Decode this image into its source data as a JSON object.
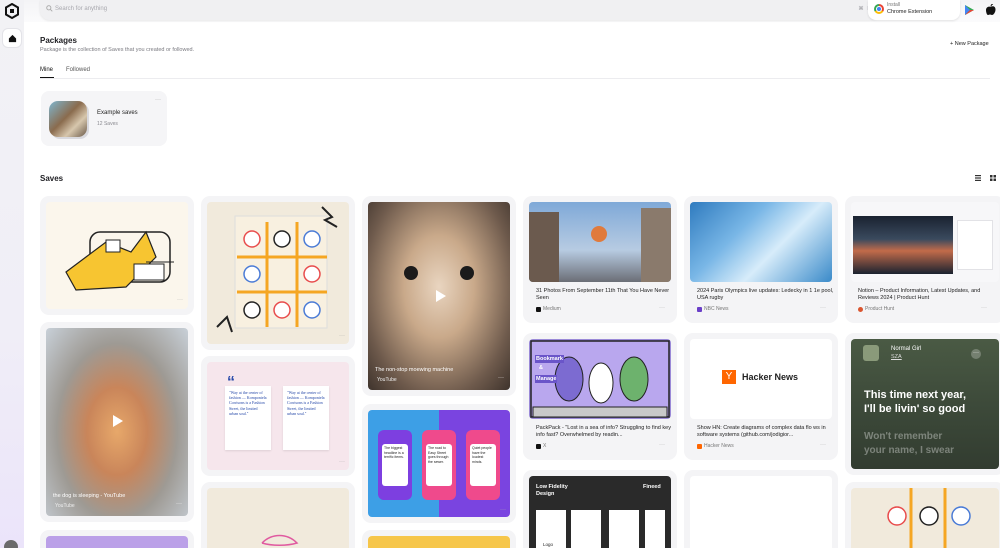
{
  "search": {
    "placeholder": "Search for anything",
    "shortcut": "⌘ K"
  },
  "extension": {
    "line1": "Install",
    "line2": "Chrome Extension"
  },
  "packages": {
    "title": "Packages",
    "subtitle": "Package is the collection of Saves that you created or followed.",
    "new_label": "+ New Package",
    "tabs": [
      "Mine",
      "Followed"
    ],
    "items": [
      {
        "name": "Example saves",
        "count": "12 Saves"
      }
    ]
  },
  "saves": {
    "title": "Saves",
    "cards": [
      {
        "title": "31 Photos From September 11th That You Have Never Seen",
        "source": "Medium"
      },
      {
        "title": "2024 Paris Olympics live updates: Ledecky in 1 1e pool, USA rugby",
        "source": "NBC News"
      },
      {
        "title": "Notion – Product Information, Latest Updates, and Reviews 2024 | Product Hunt",
        "source": "Product Hunt"
      },
      {
        "title": "The non-stop moewing machine",
        "source": "YouTube"
      },
      {
        "title": "the dog is sleeping - YouTube",
        "source": "YouTube"
      },
      {
        "title": "PackPack - \"Lost in a sea of info? Struggling to find key info fast? Overwhelmed by readin...",
        "source": "X"
      },
      {
        "title": "Show HN: Create diagrams of complex data flo ws in software systems (github.com/jodigior...",
        "source": "Hacker News"
      }
    ],
    "hn_logo": "Y",
    "hn_name": "Hacker News",
    "song": {
      "title": "Normal Girl",
      "artist": "SZA",
      "lyric1": "This time next year,",
      "lyric2": "I'll be livin' so good",
      "lyric3": "Won't remember",
      "lyric4": "your name, I swear"
    },
    "comic_text": [
      "Bookmark",
      "&",
      "Manage"
    ],
    "quote_text": "\"Way at the center of fashion — Komponiela Corrisons is a Fashion Street, the limited urban soul.\"",
    "phone_texts": [
      "The biggest headline is a terrific items.",
      "The road to Easy Street goes through the sewer.",
      "Quiet people have the loudest minds."
    ],
    "lowfi": {
      "left": "Low Fidelity Design",
      "right": "Fineed",
      "label": "Logo"
    },
    "more": "···"
  },
  "colors": {
    "accent": "#1e1e22",
    "hn": "#ff6600",
    "youtube": "#ff0000",
    "producthunt": "#da552f"
  }
}
